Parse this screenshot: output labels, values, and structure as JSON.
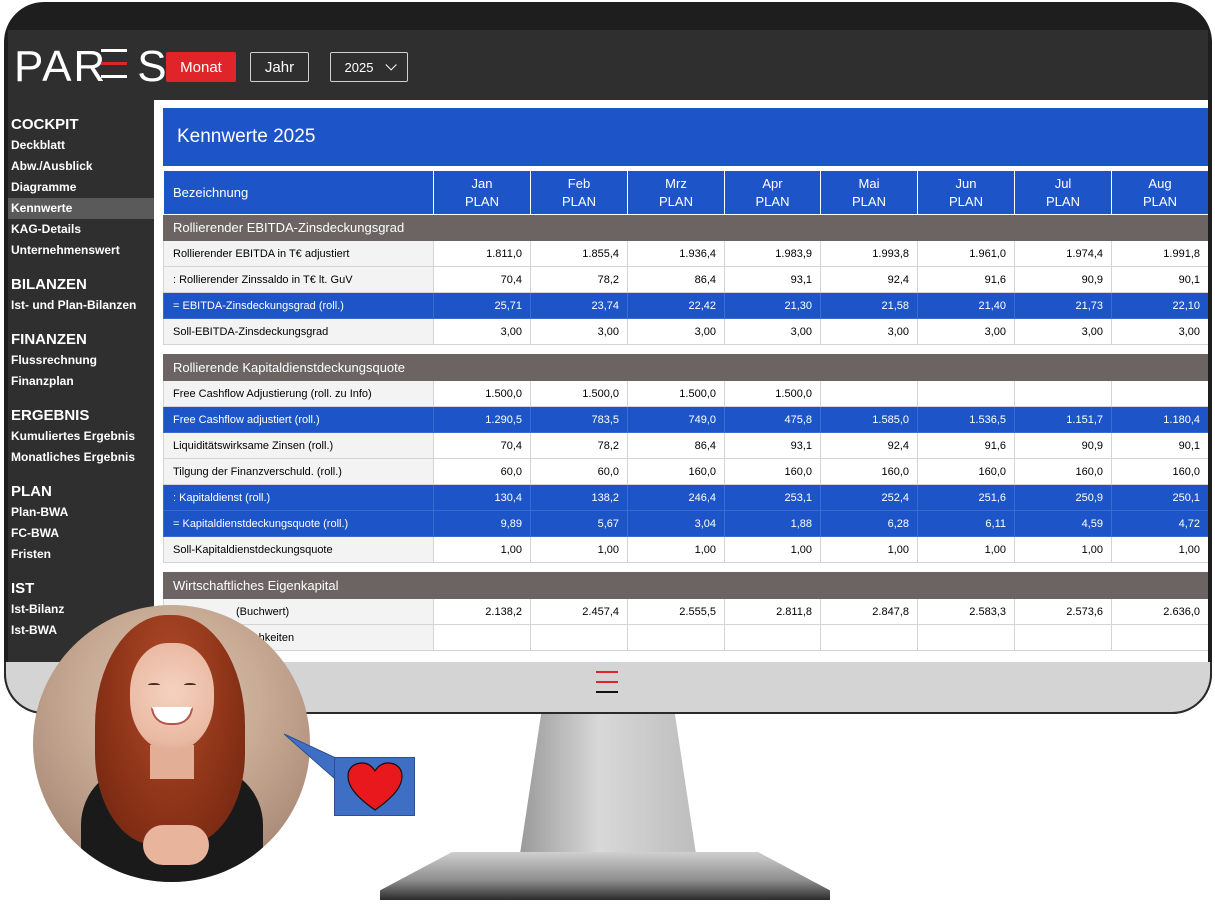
{
  "app": {
    "logo": "PARES",
    "buttons": {
      "monat": "Monat",
      "jahr": "Jahr",
      "year": "2025"
    }
  },
  "sidebar": {
    "sections": [
      {
        "title": "COCKPIT",
        "items": [
          "Deckblatt",
          "Abw./Ausblick",
          "Diagramme",
          "Kennwerte",
          "KAG-Details",
          "Unternehmenswert"
        ]
      },
      {
        "title": "BILANZEN",
        "items": [
          "Ist- und Plan-Bilanzen"
        ]
      },
      {
        "title": "FINANZEN",
        "items": [
          "Flussrechnung",
          "Finanzplan"
        ]
      },
      {
        "title": "ERGEBNIS",
        "items": [
          "Kumuliertes Ergebnis",
          "Monatliches Ergebnis"
        ]
      },
      {
        "title": "PLAN",
        "items": [
          "Plan-BWA",
          "FC-BWA",
          "Fristen"
        ]
      },
      {
        "title": "IST",
        "items": [
          "Ist-Bilanz",
          "Ist-BWA"
        ]
      }
    ],
    "active": "Kennwerte"
  },
  "content": {
    "title": "Kennwerte 2025",
    "header": {
      "label": "Bezeichnung",
      "months": [
        "Jan",
        "Feb",
        "Mrz",
        "Apr",
        "Mai",
        "Jun",
        "Jul",
        "Aug"
      ],
      "sub": "PLAN"
    },
    "sections": [
      {
        "title": "Rollierender EBITDA-Zinsdeckungsgrad",
        "rows": [
          {
            "label": "Rollierender EBITDA in T€ adjustiert",
            "style": "plain",
            "values": [
              "1.811,0",
              "1.855,4",
              "1.936,4",
              "1.983,9",
              "1.993,8",
              "1.961,0",
              "1.974,4",
              "1.991,8"
            ]
          },
          {
            "label": ": Rollierender Zinssaldo in T€ lt. GuV",
            "style": "plain",
            "values": [
              "70,4",
              "78,2",
              "86,4",
              "93,1",
              "92,4",
              "91,6",
              "90,9",
              "90,1"
            ]
          },
          {
            "label": "= EBITDA-Zinsdeckungsgrad (roll.)",
            "style": "blue",
            "values": [
              "25,71",
              "23,74",
              "22,42",
              "21,30",
              "21,58",
              "21,40",
              "21,73",
              "22,10"
            ]
          },
          {
            "label": "Soll-EBITDA-Zinsdeckungsgrad",
            "style": "plain",
            "values": [
              "3,00",
              "3,00",
              "3,00",
              "3,00",
              "3,00",
              "3,00",
              "3,00",
              "3,00"
            ]
          }
        ]
      },
      {
        "title": "Rollierende Kapitaldienstdeckungsquote",
        "rows": [
          {
            "label": "Free Cashflow Adjustierung (roll. zu Info)",
            "style": "plain",
            "values": [
              "1.500,0",
              "1.500,0",
              "1.500,0",
              "1.500,0",
              "",
              "",
              "",
              ""
            ]
          },
          {
            "label": "Free Cashflow adjustiert (roll.)",
            "style": "blue",
            "values": [
              "1.290,5",
              "783,5",
              "749,0",
              "475,8",
              "1.585,0",
              "1.536,5",
              "1.151,7",
              "1.180,4"
            ]
          },
          {
            "label": "Liquiditätswirksame Zinsen (roll.)",
            "style": "plain",
            "values": [
              "70,4",
              "78,2",
              "86,4",
              "93,1",
              "92,4",
              "91,6",
              "90,9",
              "90,1"
            ]
          },
          {
            "label": "Tilgung der Finanzverschuld. (roll.)",
            "style": "plain",
            "values": [
              "60,0",
              "60,0",
              "160,0",
              "160,0",
              "160,0",
              "160,0",
              "160,0",
              "160,0"
            ]
          },
          {
            "label": ": Kapitaldienst (roll.)",
            "style": "blue",
            "values": [
              "130,4",
              "138,2",
              "246,4",
              "253,1",
              "252,4",
              "251,6",
              "250,9",
              "250,1"
            ]
          },
          {
            "label": "= Kapitaldienstdeckungsquote (roll.)",
            "style": "blue",
            "values": [
              "9,89",
              "5,67",
              "3,04",
              "1,88",
              "6,28",
              "6,11",
              "4,59",
              "4,72"
            ]
          },
          {
            "label": "Soll-Kapitaldienstdeckungsquote",
            "style": "plain",
            "values": [
              "1,00",
              "1,00",
              "1,00",
              "1,00",
              "1,00",
              "1,00",
              "1,00",
              "1,00"
            ]
          }
        ]
      },
      {
        "title": "Wirtschaftliches Eigenkapital",
        "rows": [
          {
            "label": "(Buchwert)",
            "style": "plain",
            "values": [
              "2.138,2",
              "2.457,4",
              "2.555,5",
              "2.811,8",
              "2.847,8",
              "2.583,3",
              "2.573,6",
              "2.636,0"
            ]
          },
          {
            "label": "ndlichkeiten",
            "style": "plain",
            "values": [
              "",
              "",
              "",
              "",
              "",
              "",
              "",
              ""
            ]
          }
        ]
      }
    ]
  },
  "overlay": {
    "avatar": "smiling-woman-photo",
    "bubble_icon": "heart-icon",
    "heart_color": "#e8181c",
    "bubble_color": "#3e6fc4"
  },
  "colors": {
    "brand_red": "#e0252a",
    "table_blue": "#1d55c8",
    "section_gray": "#6b6462",
    "dark_bg": "#2f2f2f"
  }
}
